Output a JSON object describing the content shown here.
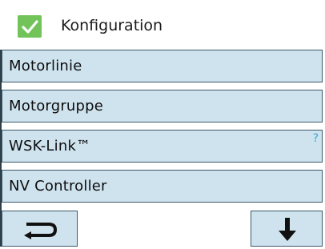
{
  "header": {
    "title": "Konfiguration",
    "check_icon": "check-icon",
    "check_color": "#72c45a"
  },
  "menu": {
    "items": [
      {
        "label": "Motorlinie"
      },
      {
        "label": "Motorgruppe"
      },
      {
        "label": "WSK-Link™",
        "help": "?"
      },
      {
        "label": "NV Controller"
      }
    ]
  },
  "nav": {
    "back_icon": "return-arrow-icon",
    "down_icon": "arrow-down-icon"
  },
  "colors": {
    "item_bg": "#cfe3ef",
    "item_border": "#3c5868",
    "help": "#3aa7d8"
  }
}
